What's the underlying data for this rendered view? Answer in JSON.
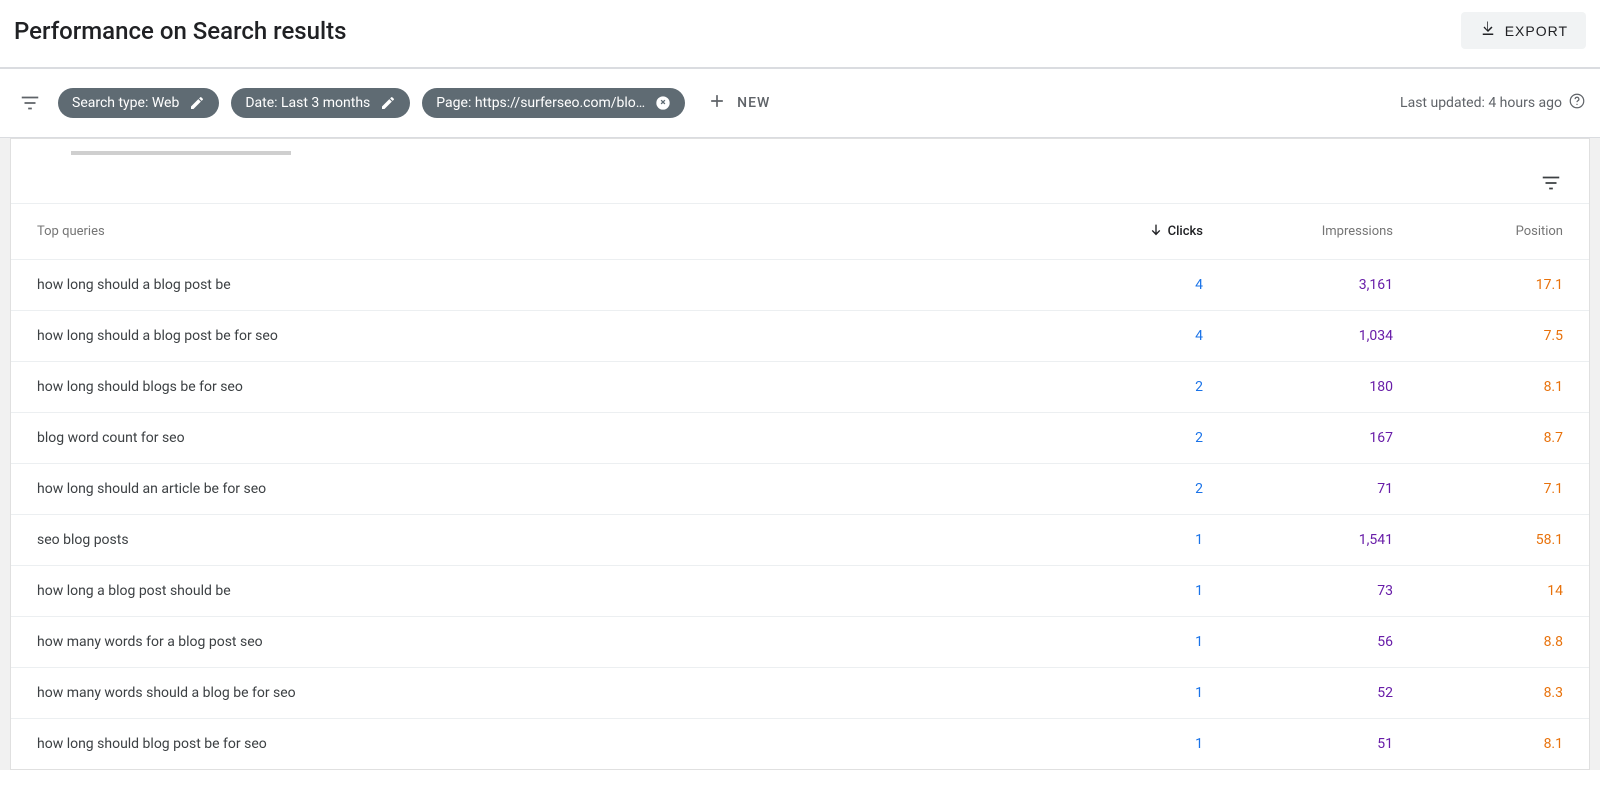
{
  "header": {
    "title": "Performance on Search results",
    "export_label": "EXPORT"
  },
  "filters": {
    "search_type": "Search type: Web",
    "date": "Date: Last 3 months",
    "page": "Page: https://surferseo.com/blo…",
    "new_label": "NEW",
    "last_updated": "Last updated: 4 hours ago"
  },
  "table": {
    "columns": {
      "queries": "Top queries",
      "clicks": "Clicks",
      "impressions": "Impressions",
      "position": "Position"
    },
    "rows": [
      {
        "query": "how long should a blog post be",
        "clicks": "4",
        "impressions": "3,161",
        "position": "17.1"
      },
      {
        "query": "how long should a blog post be for seo",
        "clicks": "4",
        "impressions": "1,034",
        "position": "7.5"
      },
      {
        "query": "how long should blogs be for seo",
        "clicks": "2",
        "impressions": "180",
        "position": "8.1"
      },
      {
        "query": "blog word count for seo",
        "clicks": "2",
        "impressions": "167",
        "position": "8.7"
      },
      {
        "query": "how long should an article be for seo",
        "clicks": "2",
        "impressions": "71",
        "position": "7.1"
      },
      {
        "query": "seo blog posts",
        "clicks": "1",
        "impressions": "1,541",
        "position": "58.1"
      },
      {
        "query": "how long a blog post should be",
        "clicks": "1",
        "impressions": "73",
        "position": "14"
      },
      {
        "query": "how many words for a blog post seo",
        "clicks": "1",
        "impressions": "56",
        "position": "8.8"
      },
      {
        "query": "how many words should a blog be for seo",
        "clicks": "1",
        "impressions": "52",
        "position": "8.3"
      },
      {
        "query": "how long should blog post be for seo",
        "clicks": "1",
        "impressions": "51",
        "position": "8.1"
      }
    ]
  }
}
